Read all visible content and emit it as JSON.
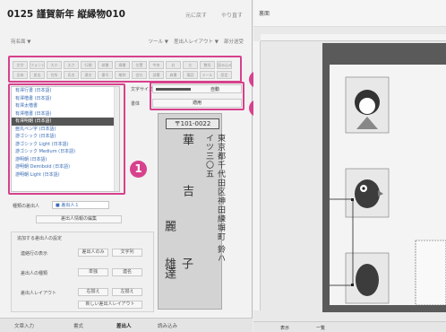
{
  "header": {
    "title": "0125 謹賀新年 縦縁物010",
    "tool_a": "元に戻す",
    "tool_b": "やり直す",
    "left_label": "宛名面 ▼",
    "menu_tool": "ツール ▼",
    "menu_layout": "差出人レイアウト ▼",
    "menu_extra": "部分送受"
  },
  "tool_rows": [
    [
      "文字",
      "フォント",
      "大小",
      "太さ",
      "行間",
      "縦書",
      "横書",
      "位置",
      "中央",
      "右",
      "左",
      "整形",
      "読み込み"
    ],
    [
      "全体",
      "差出",
      "住所",
      "氏名",
      "連名",
      "番号",
      "敬称",
      "会社",
      "部署",
      "肩書",
      "電話",
      "メール",
      "設定"
    ]
  ],
  "fonts": [
    "有澤行書 (日本語)",
    "有澤楷書 (日本語)",
    "有澤太楷書",
    "有澤楷書 (日本語)",
    "有澤明朝 (日本語)",
    "亜丸ペン字 (日本語)",
    "游ゴシック (日本語)",
    "游ゴシック Light (日本語)",
    "游ゴシック Medium (日本語)",
    "游明朝 (日本語)",
    "游明朝 Demibold (日本語)",
    "游明朝 Light (日本語)"
  ],
  "selected_font_index": 4,
  "settings": {
    "size_label": "文字サイズ",
    "size_value": "自動",
    "size_level": 0.55,
    "font_label": "書体",
    "font_button": "適用"
  },
  "badges": [
    "1",
    "2",
    "3"
  ],
  "preview": {
    "postal": "〒101-0022",
    "address": "東京都千代田区神田練塀町 鈴ハイツ三〇五",
    "name_line1": "華 吉",
    "name_line2": "麗 達",
    "name_line3": "子 雄",
    "honorific1": "様",
    "honorific2": "様"
  },
  "lower": {
    "type_label": "種類の差出人",
    "type_value": "■ 差出人１",
    "edit_button": "差出人情報の編集",
    "section_title": "追加する差出人の設定",
    "row1_label": "連絡行の表示",
    "row1_a": "差出人のみ",
    "row1_b": "文字列",
    "row2_label": "差出人の種類",
    "row2_a": "単独",
    "row2_b": "連名",
    "row3_label": "差出人レイアウト",
    "row3_a": "右揃え",
    "row3_b": "左揃え",
    "row3_c": "新しい差出人レイアウト"
  },
  "tabs": [
    "文章入力",
    "書式",
    "差出人",
    "読み込み"
  ],
  "active_tab": 2,
  "right": {
    "title": "裏面",
    "bottom_left": "表示",
    "bottom_mid": "一覧"
  },
  "colors": {
    "accent": "#d7418d"
  }
}
